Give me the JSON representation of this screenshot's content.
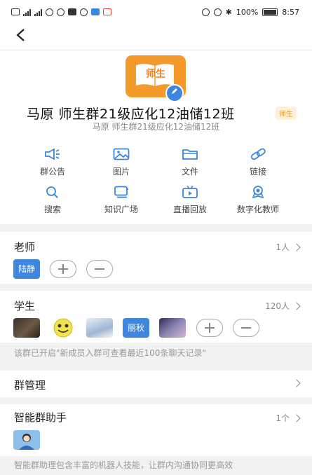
{
  "status_bar": {
    "left_network": "4G",
    "battery": "100%",
    "time": "8:57"
  },
  "nav": {
    "back_glyph": "<"
  },
  "header": {
    "logo_text": "师生",
    "group_name": "马原 师生群21级应化12油储12班",
    "tag": "师生",
    "subtitle": "马原 师生群21级应化12油储12班"
  },
  "functions": [
    {
      "label": "群公告",
      "icon": "megaphone-icon"
    },
    {
      "label": "图片",
      "icon": "image-icon"
    },
    {
      "label": "文件",
      "icon": "folder-icon"
    },
    {
      "label": "链接",
      "icon": "link-icon"
    },
    {
      "label": "搜索",
      "icon": "search-icon"
    },
    {
      "label": "知识广场",
      "icon": "knowledge-icon"
    },
    {
      "label": "直播回放",
      "icon": "tv-icon"
    },
    {
      "label": "数字化教师",
      "icon": "badge-icon"
    }
  ],
  "teachers": {
    "title": "老师",
    "count": "1人",
    "members": [
      "陆静"
    ]
  },
  "students": {
    "title": "学生",
    "count": "120人",
    "members": [
      "",
      "",
      "",
      "丽秋",
      ""
    ]
  },
  "notice": "该群已开启\"新成员入群可查看最近100条聊天记录\"",
  "group_manage": {
    "title": "群管理"
  },
  "assistant": {
    "title": "智能群助手",
    "count": "1个",
    "description": "智能群助理包含丰富的机器人技能，让群内沟通协同更高效"
  },
  "colors": {
    "accent_blue": "#3a86e0",
    "logo_orange": "#f39a2b",
    "tag_bg": "#fdf1de"
  }
}
